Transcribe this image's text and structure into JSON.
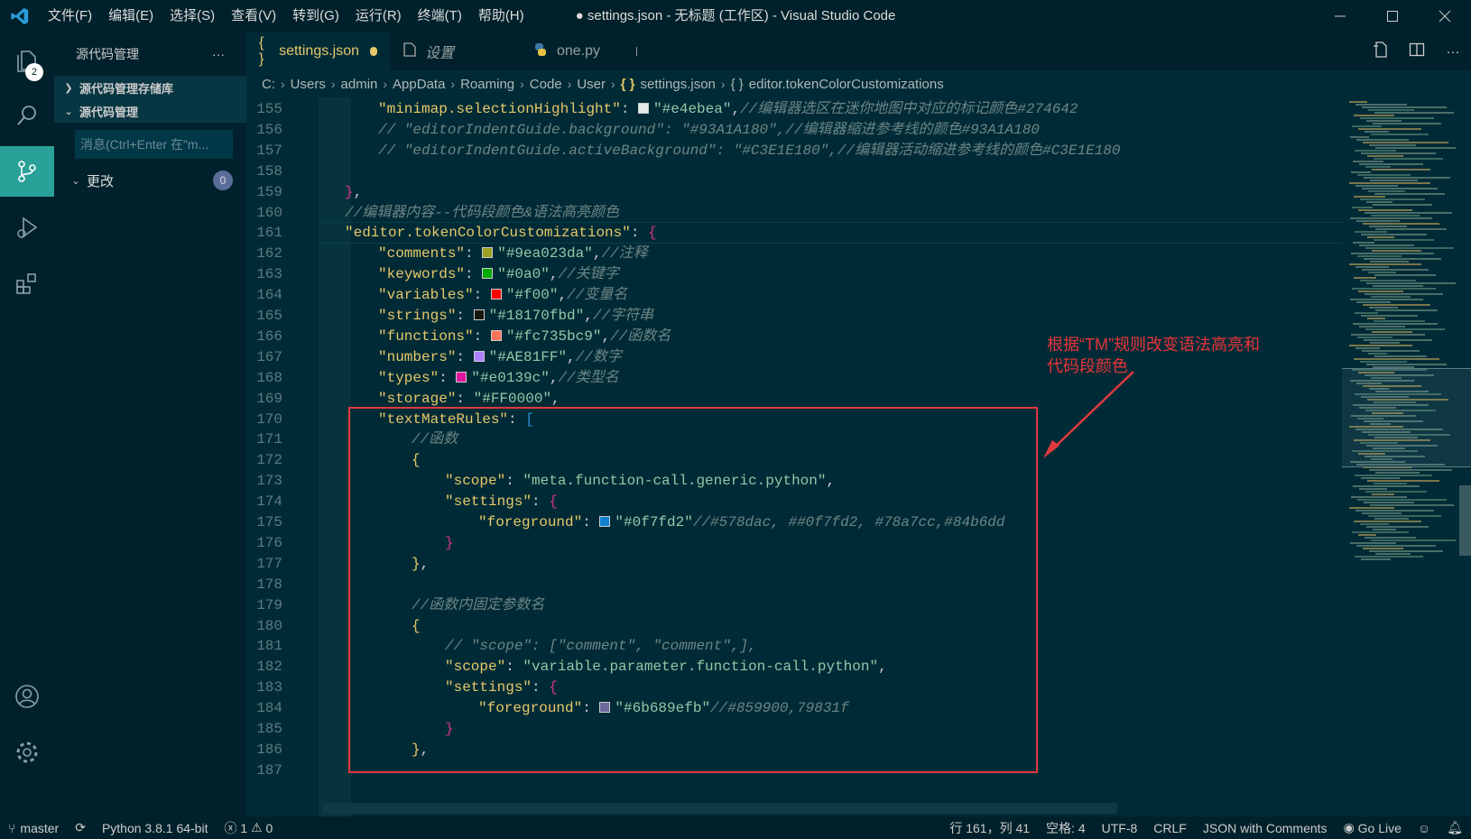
{
  "titlebar": {
    "menu": [
      "文件(F)",
      "编辑(E)",
      "选择(S)",
      "查看(V)",
      "转到(G)",
      "运行(R)",
      "终端(T)",
      "帮助(H)"
    ],
    "window_title": "● settings.json - 无标题 (工作区) - Visual Studio Code"
  },
  "activity": {
    "explorer_badge": "2"
  },
  "sidebar": {
    "title": "源代码管理",
    "more": "···",
    "repos_label": "源代码管理存储库",
    "scm_label": "源代码管理",
    "message_placeholder": "消息(Ctrl+Enter 在\"m...",
    "changes_label": "更改",
    "changes_count": "0"
  },
  "tabs": [
    {
      "label": "settings.json",
      "icon": "{ }"
    },
    {
      "label": "设置",
      "icon": "file-icon"
    },
    {
      "label": "one.py",
      "icon": "python-icon"
    }
  ],
  "breadcrumb": {
    "items": [
      "C:",
      "Users",
      "admin",
      "AppData",
      "Roaming",
      "Code",
      "User"
    ],
    "file": "settings.json",
    "symbol": "editor.tokenColorCustomizations",
    "brace": "{ }"
  },
  "editor": {
    "lines": [
      {
        "n": "155",
        "indent": 2,
        "tokens": [
          {
            "t": "\"minimap.selectionHighlight\"",
            "c": "k"
          },
          {
            "t": ": ",
            "c": "p"
          },
          {
            "sw": "#e4ebea"
          },
          {
            "t": "\"#e4ebea\"",
            "c": "s"
          },
          {
            "t": ",",
            "c": "p"
          },
          {
            "t": "//编辑器选区在迷你地图中对应的标记颜色#274642",
            "c": "c"
          }
        ]
      },
      {
        "n": "156",
        "indent": 2,
        "tokens": [
          {
            "t": "// \"editorIndentGuide.background\": \"#93A1A180\",//编辑器缩进参考线的颜色#93A1A180",
            "c": "c"
          }
        ]
      },
      {
        "n": "157",
        "indent": 2,
        "tokens": [
          {
            "t": "// \"editorIndentGuide.activeBackground\": \"#C3E1E180\",//编辑器活动缩进参考线的颜色#C3E1E180",
            "c": "c"
          }
        ]
      },
      {
        "n": "158",
        "indent": 0,
        "tokens": []
      },
      {
        "n": "159",
        "indent": 1,
        "tokens": [
          {
            "t": "}",
            "c": "b2"
          },
          {
            "t": ",",
            "c": "p"
          }
        ]
      },
      {
        "n": "160",
        "indent": 1,
        "tokens": [
          {
            "t": "//编辑器内容--代码段颜色&语法高亮颜色",
            "c": "c"
          }
        ]
      },
      {
        "n": "161",
        "indent": 1,
        "tokens": [
          {
            "t": "\"editor.tokenColorCustomizations\"",
            "c": "k"
          },
          {
            "t": ": ",
            "c": "p"
          },
          {
            "t": "{",
            "c": "b2"
          }
        ]
      },
      {
        "n": "162",
        "indent": 2,
        "tokens": [
          {
            "t": "\"comments\"",
            "c": "k"
          },
          {
            "t": ": ",
            "c": "p"
          },
          {
            "sw": "#9ea023"
          },
          {
            "t": "\"#9ea023da\"",
            "c": "s"
          },
          {
            "t": ",",
            "c": "p"
          },
          {
            "t": "//注释",
            "c": "c"
          }
        ]
      },
      {
        "n": "163",
        "indent": 2,
        "tokens": [
          {
            "t": "\"keywords\"",
            "c": "k"
          },
          {
            "t": ": ",
            "c": "p"
          },
          {
            "sw": "#00aa00"
          },
          {
            "t": "\"#0a0\"",
            "c": "s"
          },
          {
            "t": ",",
            "c": "p"
          },
          {
            "t": "//关键字",
            "c": "c"
          }
        ]
      },
      {
        "n": "164",
        "indent": 2,
        "tokens": [
          {
            "t": "\"variables\"",
            "c": "k"
          },
          {
            "t": ": ",
            "c": "p"
          },
          {
            "sw": "#ff0000"
          },
          {
            "t": "\"#f00\"",
            "c": "s"
          },
          {
            "t": ",",
            "c": "p"
          },
          {
            "t": "//变量名",
            "c": "c"
          }
        ]
      },
      {
        "n": "165",
        "indent": 2,
        "tokens": [
          {
            "t": "\"strings\"",
            "c": "k"
          },
          {
            "t": ": ",
            "c": "p"
          },
          {
            "sw": "#18170f"
          },
          {
            "t": "\"#18170fbd\"",
            "c": "s"
          },
          {
            "t": ",",
            "c": "p"
          },
          {
            "t": "//字符串",
            "c": "c"
          }
        ]
      },
      {
        "n": "166",
        "indent": 2,
        "tokens": [
          {
            "t": "\"functions\"",
            "c": "k"
          },
          {
            "t": ": ",
            "c": "p"
          },
          {
            "sw": "#fc735b"
          },
          {
            "t": "\"#fc735bc9\"",
            "c": "s"
          },
          {
            "t": ",",
            "c": "p"
          },
          {
            "t": "//函数名",
            "c": "c"
          }
        ]
      },
      {
        "n": "167",
        "indent": 2,
        "tokens": [
          {
            "t": "\"numbers\"",
            "c": "k"
          },
          {
            "t": ": ",
            "c": "p"
          },
          {
            "sw": "#AE81FF"
          },
          {
            "t": "\"#AE81FF\"",
            "c": "s"
          },
          {
            "t": ",",
            "c": "p"
          },
          {
            "t": "//数字",
            "c": "c"
          }
        ]
      },
      {
        "n": "168",
        "indent": 2,
        "tokens": [
          {
            "t": "\"types\"",
            "c": "k"
          },
          {
            "t": ": ",
            "c": "p"
          },
          {
            "sw": "#e0139c"
          },
          {
            "t": "\"#e0139c\"",
            "c": "s"
          },
          {
            "t": ",",
            "c": "p"
          },
          {
            "t": "//类型名",
            "c": "c"
          }
        ]
      },
      {
        "n": "169",
        "indent": 2,
        "tokens": [
          {
            "t": "\"storage\"",
            "c": "k"
          },
          {
            "t": ": ",
            "c": "p"
          },
          {
            "t": "\"#FF0000\"",
            "c": "s"
          },
          {
            "t": ",",
            "c": "p"
          }
        ]
      },
      {
        "n": "170",
        "indent": 2,
        "tokens": [
          {
            "t": "\"textMateRules\"",
            "c": "k"
          },
          {
            "t": ": ",
            "c": "p"
          },
          {
            "t": "[",
            "c": "b3"
          }
        ]
      },
      {
        "n": "171",
        "indent": 3,
        "tokens": [
          {
            "t": "//函数",
            "c": "c"
          }
        ]
      },
      {
        "n": "172",
        "indent": 3,
        "tokens": [
          {
            "t": "{",
            "c": "b1"
          }
        ]
      },
      {
        "n": "173",
        "indent": 4,
        "tokens": [
          {
            "t": "\"scope\"",
            "c": "k"
          },
          {
            "t": ": ",
            "c": "p"
          },
          {
            "t": "\"meta.function-call.generic.python\"",
            "c": "s"
          },
          {
            "t": ",",
            "c": "p"
          }
        ]
      },
      {
        "n": "174",
        "indent": 4,
        "tokens": [
          {
            "t": "\"settings\"",
            "c": "k"
          },
          {
            "t": ": ",
            "c": "p"
          },
          {
            "t": "{",
            "c": "b2"
          }
        ]
      },
      {
        "n": "175",
        "indent": 5,
        "tokens": [
          {
            "t": "\"foreground\"",
            "c": "k"
          },
          {
            "t": ": ",
            "c": "p"
          },
          {
            "sw": "#0f7fd2"
          },
          {
            "t": "\"#0f7fd2\"",
            "c": "s"
          },
          {
            "t": "//#578dac, ##0f7fd2, #78a7cc,#84b6dd",
            "c": "c"
          }
        ]
      },
      {
        "n": "176",
        "indent": 4,
        "tokens": [
          {
            "t": "}",
            "c": "b2"
          }
        ]
      },
      {
        "n": "177",
        "indent": 3,
        "tokens": [
          {
            "t": "}",
            "c": "b1"
          },
          {
            "t": ",",
            "c": "p"
          }
        ]
      },
      {
        "n": "178",
        "indent": 0,
        "tokens": []
      },
      {
        "n": "179",
        "indent": 3,
        "tokens": [
          {
            "t": "//函数内固定参数名",
            "c": "c"
          }
        ]
      },
      {
        "n": "180",
        "indent": 3,
        "tokens": [
          {
            "t": "{",
            "c": "b1"
          }
        ]
      },
      {
        "n": "181",
        "indent": 4,
        "tokens": [
          {
            "t": "// \"scope\": [\"comment\", \"comment\",],",
            "c": "c"
          }
        ]
      },
      {
        "n": "182",
        "indent": 4,
        "tokens": [
          {
            "t": "\"scope\"",
            "c": "k"
          },
          {
            "t": ": ",
            "c": "p"
          },
          {
            "t": "\"variable.parameter.function-call.python\"",
            "c": "s"
          },
          {
            "t": ",",
            "c": "p"
          }
        ]
      },
      {
        "n": "183",
        "indent": 4,
        "tokens": [
          {
            "t": "\"settings\"",
            "c": "k"
          },
          {
            "t": ": ",
            "c": "p"
          },
          {
            "t": "{",
            "c": "b2"
          }
        ]
      },
      {
        "n": "184",
        "indent": 5,
        "tokens": [
          {
            "t": "\"foreground\"",
            "c": "k"
          },
          {
            "t": ": ",
            "c": "p"
          },
          {
            "sw": "#6b689e"
          },
          {
            "t": "\"#6b689efb\"",
            "c": "s"
          },
          {
            "t": "//#859900,79831f",
            "c": "c"
          }
        ]
      },
      {
        "n": "185",
        "indent": 4,
        "tokens": [
          {
            "t": "}",
            "c": "b2"
          }
        ]
      },
      {
        "n": "186",
        "indent": 3,
        "tokens": [
          {
            "t": "}",
            "c": "b1"
          },
          {
            "t": ",",
            "c": "p"
          }
        ]
      },
      {
        "n": "187",
        "indent": 0,
        "tokens": []
      }
    ]
  },
  "annotation": {
    "line1": "根据“TM”规则改变语法高亮和",
    "line2": "代码段颜色"
  },
  "statusbar": {
    "branch": "master",
    "python": "Python 3.8.1 64-bit",
    "errors": "1",
    "warnings": "0",
    "position": "行 161，列 41",
    "spaces": "空格: 4",
    "encoding": "UTF-8",
    "eol": "CRLF",
    "language": "JSON with Comments",
    "golive": "Go Live"
  },
  "colors": {
    "accent": "#2aa198",
    "annotation": "#e0393e"
  }
}
